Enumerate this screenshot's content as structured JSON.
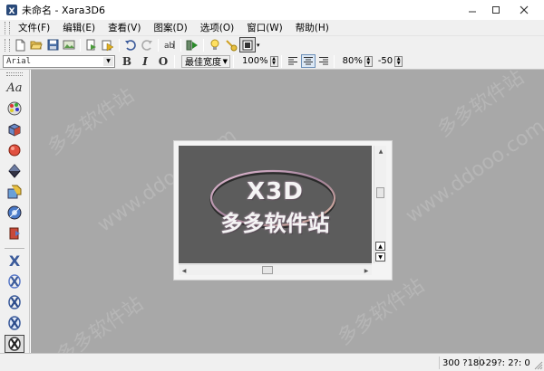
{
  "window": {
    "title": "未命名 - Xara3D6",
    "controls": [
      "minimize-icon",
      "maximize-icon",
      "close-icon"
    ]
  },
  "menu": {
    "items": [
      "文件(F)",
      "编辑(E)",
      "查看(V)",
      "图案(D)",
      "选项(O)",
      "窗口(W)",
      "帮助(H)"
    ]
  },
  "toolbar": {
    "icons": [
      "new-file-icon",
      "open-folder-icon",
      "save-icon",
      "export-image-icon",
      "export-animation-icon",
      "export-movie-icon",
      "undo-icon",
      "redo-icon",
      "text-edit-icon",
      "play-animation-icon",
      "light-bulb-icon",
      "lights-toggle-icon",
      "frame-view-icon"
    ]
  },
  "format_bar": {
    "font_name": "Arial",
    "bold_label": "B",
    "italic_label": "I",
    "outline_label": "O",
    "quality": "最佳宽度",
    "scale": "100%",
    "zoom": "80%",
    "rotation": "-50",
    "align_active": "center"
  },
  "sidebar": {
    "text_options_label": "Aa",
    "tools": [
      "text-options-icon",
      "color-palette-icon",
      "extrude-icon",
      "bevel-icon",
      "shadow-icon",
      "texture-icon",
      "lighting-icon",
      "animation-icon",
      "x-style-1-icon",
      "x-style-2-icon",
      "x-style-3-icon",
      "x-style-4-icon",
      "x-style-5-icon"
    ]
  },
  "document": {
    "title_text": "X3D",
    "subtitle_text": "多多软件站",
    "background": "#5c5c5c",
    "ellipse_color": "#c8a0b8"
  },
  "watermark": {
    "text": "多多软件站",
    "url": "www.ddooo.com"
  },
  "status": {
    "dimensions": "300 ?180",
    "rotation": "-29?: 2?: 0"
  },
  "colors": {
    "canvas_bg": "#a8a8a8",
    "chrome_bg": "#f0f0f0",
    "active_blue": "#6b8fb8"
  }
}
